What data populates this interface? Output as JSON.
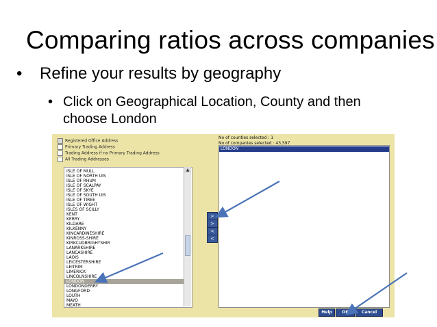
{
  "slide": {
    "title": "Comparing ratios across companies",
    "bullet1": "Refine your results by geography",
    "bullet2_line1": "Click on Geographical Location, County and then",
    "bullet2_line2": "choose London"
  },
  "options": [
    {
      "label": "Registered Office Address",
      "checked": true
    },
    {
      "label": "Primary Trading Address",
      "checked": false
    },
    {
      "label": "Trading Address if no Primary Trading Address",
      "checked": false
    },
    {
      "label": "All Trading Addresses",
      "checked": false
    }
  ],
  "county_list": [
    "ISLE OF MULL",
    "ISLE OF NORTH UIS",
    "ISLE OF RHUM",
    "ISLE OF SCALPAY",
    "ISLE OF SKYE",
    "ISLE OF SOUTH UIS",
    "ISLE OF TIREE",
    "ISLE OF WIGHT",
    "ISLES OF SCILLY",
    "KENT",
    "KERRY",
    "KILDARE",
    "KILKENNY",
    "KINCARDINESHIRE",
    "KINROSS-SHIRE",
    "KIRKCUDBRIGHTSHIR",
    "LANARKSHIRE",
    "LANCASHIRE",
    "LAOIS",
    "LEICESTERSHIRE",
    "LEITRIM",
    "LIMERICK",
    "LINCOLNSHIRE",
    "LONDON",
    "LONDONDERRY",
    "LONGFORD",
    "LOUTH",
    "MAYO",
    "MEATH"
  ],
  "selected_index": 23,
  "move_buttons": [
    ">",
    ">",
    "<",
    "<"
  ],
  "info": {
    "counties": "No of counties selected : 1",
    "companies": "No of companies selected : 43,597"
  },
  "selected_counties": [
    "LONDON"
  ],
  "buttons": {
    "help": "Help",
    "ok": "OK",
    "cancel": "Cancel"
  },
  "colors": {
    "panel": "#ece4a6",
    "arrow": "#4a73b8",
    "selection": "#233d8a"
  }
}
